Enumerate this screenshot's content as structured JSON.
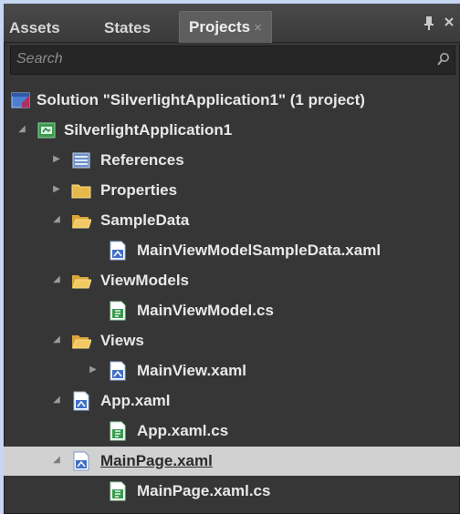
{
  "tabs": [
    {
      "label": "Assets"
    },
    {
      "label": "States"
    },
    {
      "label": "Projects",
      "close": "×"
    }
  ],
  "search": {
    "placeholder": "Search"
  },
  "tree": {
    "solution": "Solution \"SilverlightApplication1\" (1 project)",
    "project": "SilverlightApplication1",
    "references": "References",
    "properties": "Properties",
    "sampledata": "SampleData",
    "sampledata_file": "MainViewModelSampleData.xaml",
    "viewmodels": "ViewModels",
    "viewmodels_file": "MainViewModel.cs",
    "views": "Views",
    "views_file": "MainView.xaml",
    "app": "App.xaml",
    "app_cs": "App.xaml.cs",
    "mainpage": "MainPage.xaml",
    "mainpage_cs": "MainPage.xaml.cs"
  },
  "colors": {
    "panel_bg": "#363636",
    "selected_row": "#d1d1d1",
    "folder": "#e8b84a",
    "outer_bg": "#c7d6f2"
  }
}
